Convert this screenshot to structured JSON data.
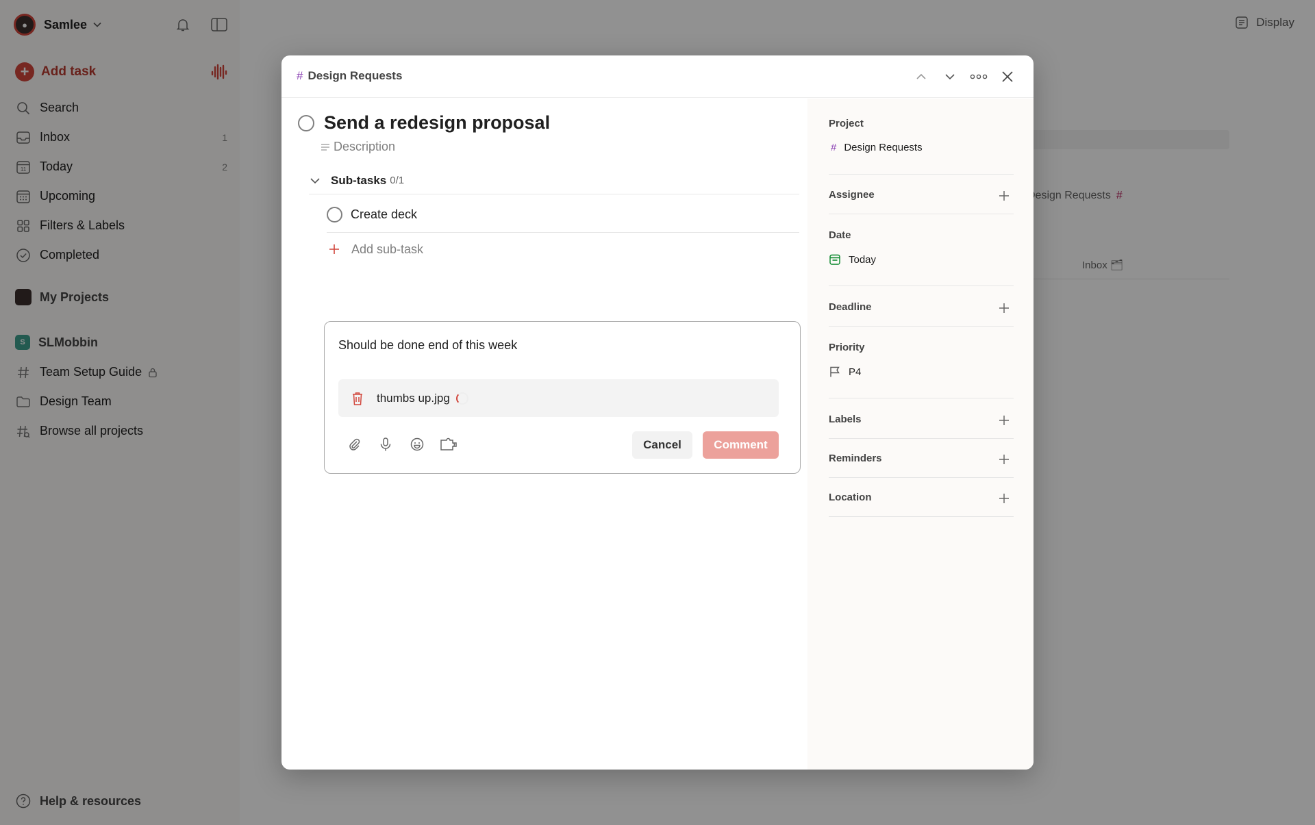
{
  "sidebar": {
    "user": {
      "name": "Samlee"
    },
    "add_task": "Add task",
    "nav": [
      {
        "label": "Search",
        "count": ""
      },
      {
        "label": "Inbox",
        "count": "1"
      },
      {
        "label": "Today",
        "count": "2"
      },
      {
        "label": "Upcoming",
        "count": ""
      },
      {
        "label": "Filters & Labels",
        "count": ""
      },
      {
        "label": "Completed",
        "count": ""
      }
    ],
    "my_projects": "My Projects",
    "workspace": {
      "badge": "S",
      "name": "SLMobbin"
    },
    "projects": [
      {
        "label": "Team Setup Guide"
      },
      {
        "label": "Design Team"
      },
      {
        "label": "Browse all projects"
      }
    ],
    "help": "Help & resources"
  },
  "background": {
    "display": "Display",
    "project_name": "Design Requests",
    "inbox_label": "Inbox"
  },
  "modal": {
    "breadcrumb": "Design Requests",
    "task_title": "Send a redesign proposal",
    "description_placeholder": "Description",
    "subtasks": {
      "title": "Sub-tasks",
      "count": "0/1"
    },
    "subtask_items": [
      {
        "label": "Create deck"
      }
    ],
    "add_subtask": "Add sub-task",
    "comment": {
      "text": "Should be done end of this week",
      "attachment_name": "thumbs up.jpg",
      "cancel": "Cancel",
      "submit": "Comment"
    },
    "details": {
      "project": {
        "label": "Project",
        "value": "Design Requests"
      },
      "assignee": {
        "label": "Assignee"
      },
      "date": {
        "label": "Date",
        "value": "Today"
      },
      "deadline": {
        "label": "Deadline"
      },
      "priority": {
        "label": "Priority",
        "value": "P4"
      },
      "labels": {
        "label": "Labels"
      },
      "reminders": {
        "label": "Reminders"
      },
      "location": {
        "label": "Location"
      }
    }
  },
  "colors": {
    "accent": "#d1453b",
    "project_hash": "#8a3fb3",
    "date_green": "#058527",
    "comment_disabled": "#eca19b"
  }
}
